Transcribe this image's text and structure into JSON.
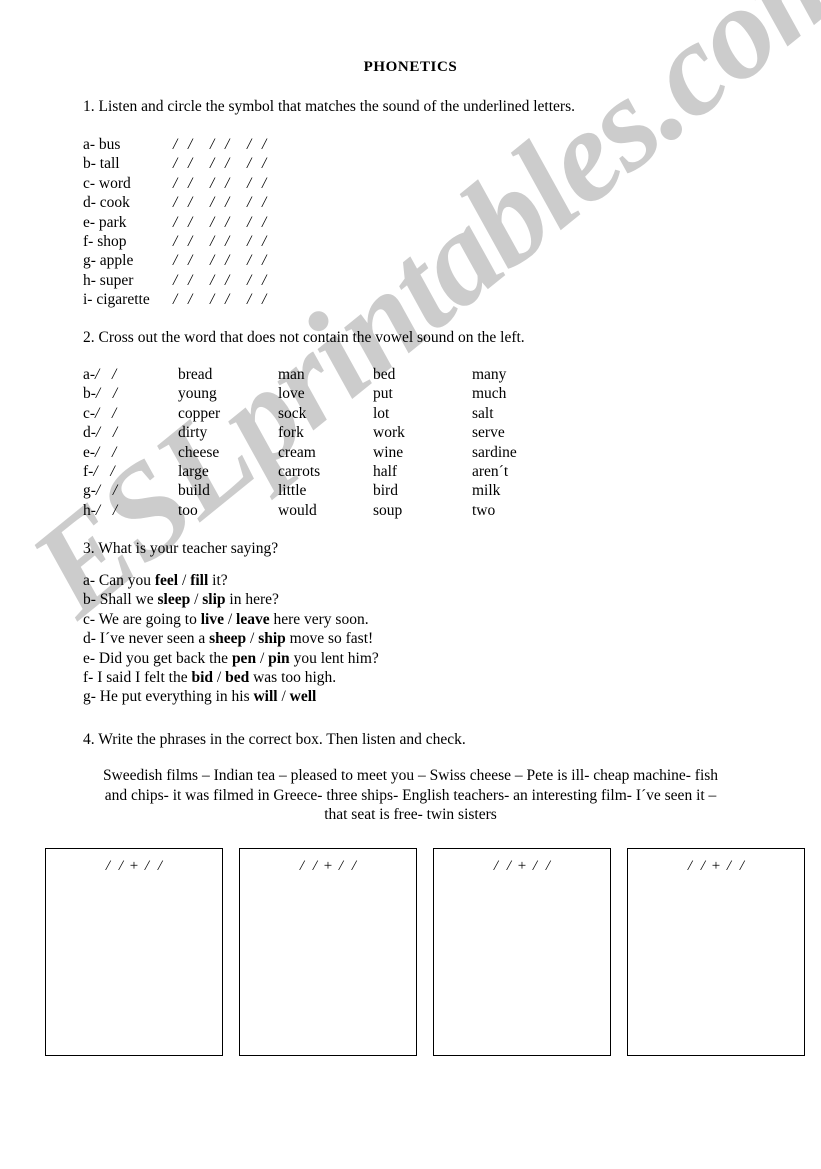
{
  "document": {
    "title": "PHONETICS",
    "watermark": "ESLprintables.com",
    "watermark_color": "#cccccc"
  },
  "exercise1": {
    "instruction": "1. Listen and circle the symbol that matches the sound of the underlined letters.",
    "slot_symbol": "/",
    "rows": [
      {
        "label": "a- bus"
      },
      {
        "label": "b- tall"
      },
      {
        "label": "c- word"
      },
      {
        "label": "d- cook"
      },
      {
        "label": "e- park"
      },
      {
        "label": "f-  shop"
      },
      {
        "label": "g- apple"
      },
      {
        "label": "h- super"
      },
      {
        "label": "i-  cigarette"
      }
    ]
  },
  "exercise2": {
    "instruction": "2. Cross out the word that does not contain the vowel sound on the left.",
    "slot_symbol": "/",
    "rows": [
      {
        "key": "a-",
        "words": [
          "bread",
          "man",
          "bed",
          "many"
        ]
      },
      {
        "key": "b-",
        "words": [
          "young",
          "love",
          "put",
          "much"
        ]
      },
      {
        "key": "c-",
        "words": [
          "copper",
          "sock",
          "lot",
          "salt"
        ]
      },
      {
        "key": "d-",
        "words": [
          "dirty",
          "fork",
          "work",
          "serve"
        ]
      },
      {
        "key": "e-",
        "words": [
          "cheese",
          "cream",
          "wine",
          "sardine"
        ]
      },
      {
        "key": "f-",
        "words": [
          "large",
          "carrots",
          "half",
          "aren´t"
        ]
      },
      {
        "key": "g-",
        "words": [
          "build",
          "little",
          "bird",
          "milk"
        ]
      },
      {
        "key": "h-",
        "words": [
          "too",
          "would",
          "soup",
          "two"
        ]
      }
    ]
  },
  "exercise3": {
    "instruction": "3. What is your teacher saying?",
    "rows": [
      {
        "prefix": "a- Can you ",
        "bold1": "feel",
        "sep": " / ",
        "bold2": "fill",
        "suffix": " it?"
      },
      {
        "prefix": "b- Shall we ",
        "bold1": "sleep",
        "sep": " / ",
        "bold2": "slip",
        "suffix": " in here?"
      },
      {
        "prefix": "c- We are going to ",
        "bold1": "live",
        "sep": " / ",
        "bold2": "leave",
        "suffix": " here very soon."
      },
      {
        "prefix": "d- I´ve never seen a ",
        "bold1": "sheep",
        "sep": " / ",
        "bold2": "ship",
        "suffix": " move so fast!"
      },
      {
        "prefix": "e- Did you get back the ",
        "bold1": "pen",
        "sep": " / ",
        "bold2": "pin",
        "suffix": " you lent him?"
      },
      {
        "prefix": "f- I said I felt  the ",
        "bold1": "bid",
        "sep": " / ",
        "bold2": "bed",
        "suffix": " was too high."
      },
      {
        "prefix": "g- He put everything in his ",
        "bold1": "will",
        "sep": " / ",
        "bold2": "well",
        "suffix": ""
      }
    ]
  },
  "exercise4": {
    "instruction": "4. Write the phrases in the correct box. Then listen and check.",
    "phrase_bank_lines": [
      "Sweedish films – Indian tea – pleased to meet you – Swiss cheese – Pete is ill- cheap machine- fish",
      "and chips- it was filmed in Greece- three ships- English teachers- an interesting film- I´ve seen it –",
      "that seat is free- twin sisters"
    ],
    "boxes": [
      {
        "header_slots": [
          "/",
          "/",
          "+",
          "/",
          "/"
        ]
      },
      {
        "header_slots": [
          "/",
          "/",
          "+",
          "/",
          "/"
        ]
      },
      {
        "header_slots": [
          "/",
          "/",
          "+",
          "/",
          "/"
        ]
      },
      {
        "header_slots": [
          "/",
          "/",
          "+",
          "/",
          "/"
        ]
      }
    ]
  }
}
